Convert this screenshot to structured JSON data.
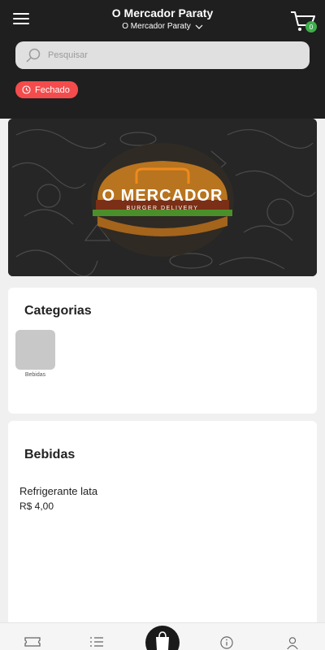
{
  "header": {
    "title": "O Mercador Paraty",
    "store_selector": "O Mercador Paraty",
    "cart_count": "0"
  },
  "search": {
    "placeholder": "Pesquisar"
  },
  "status_badge": {
    "label": "Fechado"
  },
  "banner": {
    "brand": "O MERCADOR",
    "tagline": "BURGER DELIVERY"
  },
  "categories": {
    "title": "Categorias",
    "items": [
      {
        "label": "Bebidas"
      }
    ]
  },
  "section": {
    "title": "Bebidas",
    "products": [
      {
        "name": "Refrigerante lata",
        "price": "R$ 4,00"
      }
    ]
  },
  "bottom_nav": {
    "items": [
      "ticket-icon",
      "list-icon",
      "bag-icon",
      "info-icon",
      "user-icon"
    ]
  },
  "colors": {
    "header_bg": "#1f1f1f",
    "status_red": "#f44c4c",
    "badge_green": "#3dad4b",
    "brand_orange": "#f08a1c"
  }
}
